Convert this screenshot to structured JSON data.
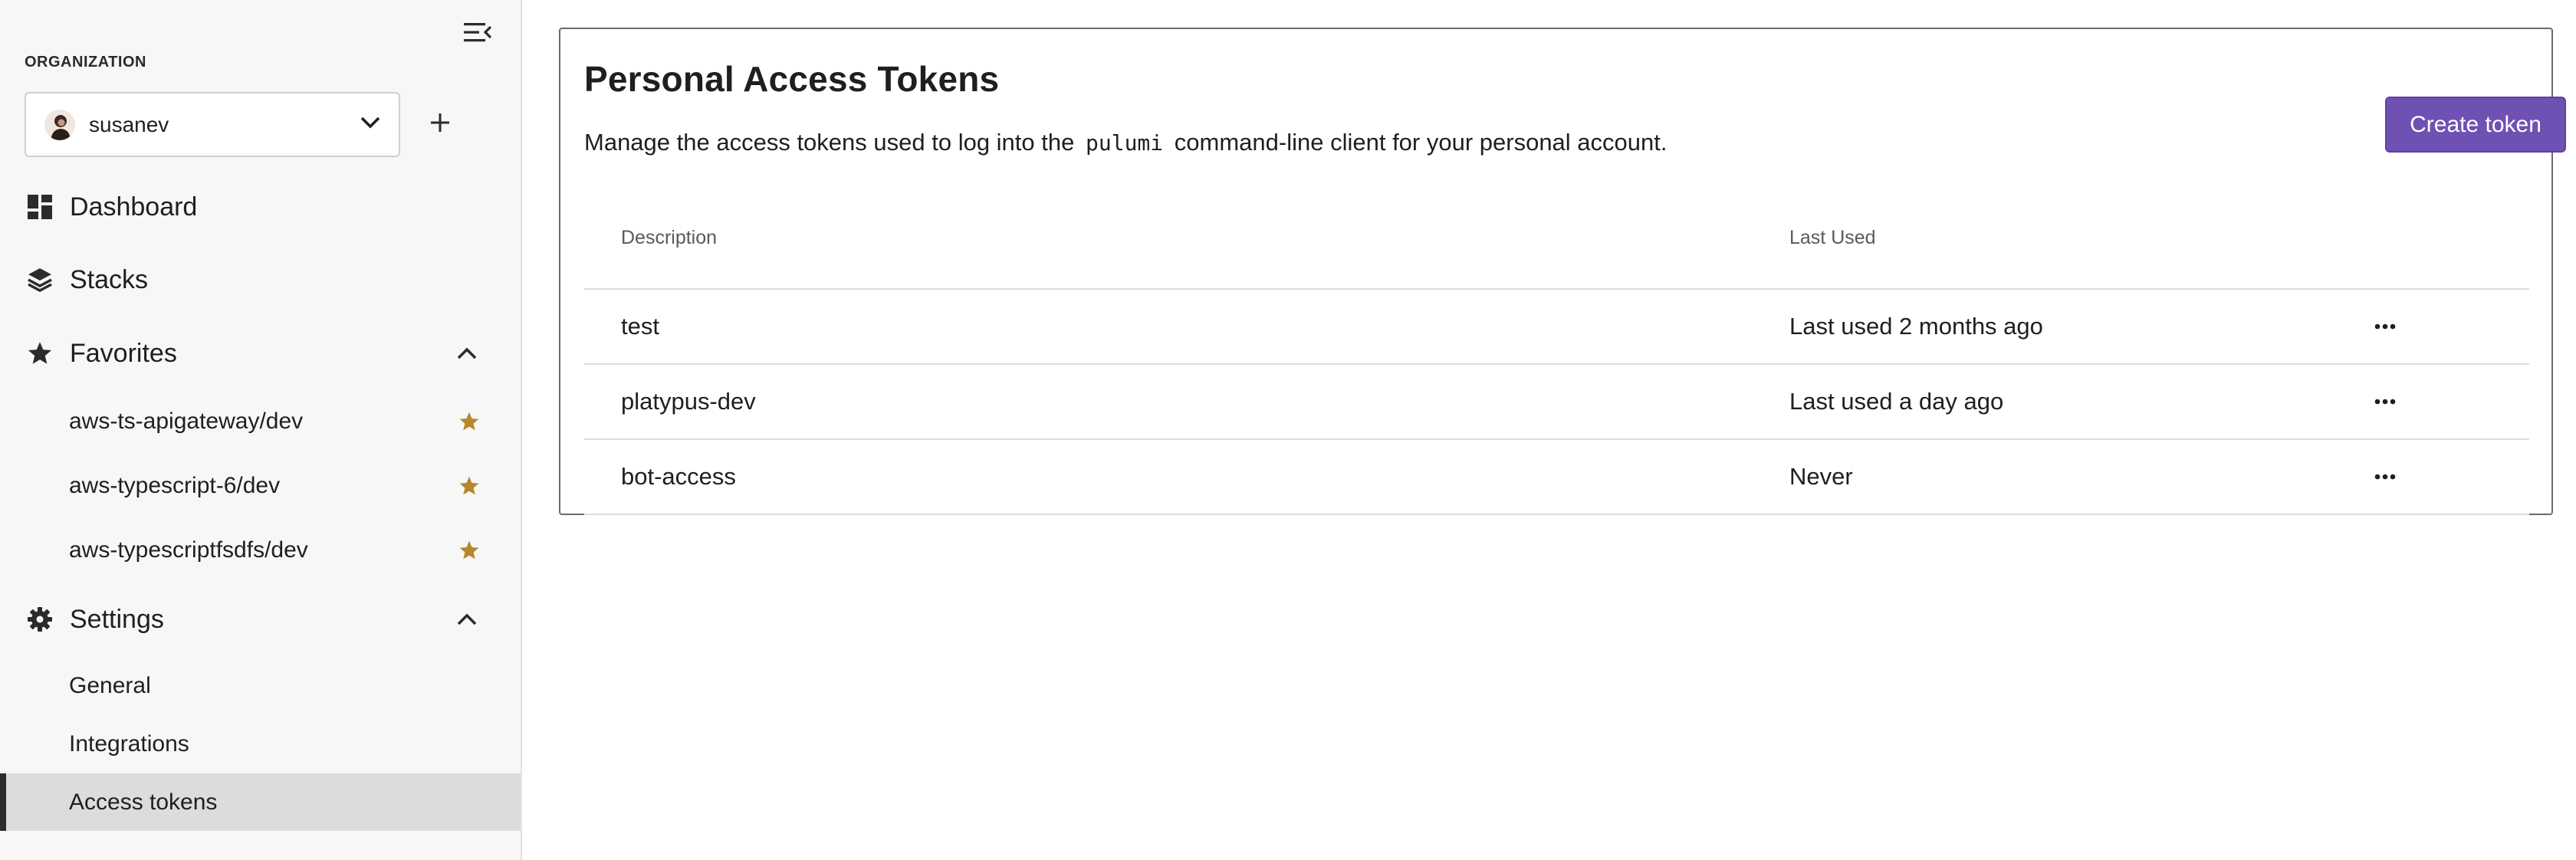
{
  "sidebar": {
    "collapse_icon": "menu-collapse-icon",
    "organization_label": "ORGANIZATION",
    "organization": {
      "name": "susanev",
      "avatar_icon": "user-avatar",
      "chevron_icon": "chevron-down-icon",
      "add_icon": "plus-icon"
    },
    "nav": [
      {
        "label": "Dashboard",
        "icon": "dashboard-icon"
      },
      {
        "label": "Stacks",
        "icon": "layers-icon"
      },
      {
        "label": "Favorites",
        "icon": "star-icon",
        "expanded": true
      },
      {
        "label": "Settings",
        "icon": "gear-icon",
        "expanded": true
      }
    ],
    "favorites": [
      {
        "label": "aws-ts-apigateway/dev",
        "icon": "star-icon"
      },
      {
        "label": "aws-typescript-6/dev",
        "icon": "star-icon"
      },
      {
        "label": "aws-typescriptfsdfs/dev",
        "icon": "star-icon"
      }
    ],
    "settings_items": [
      {
        "label": "General"
      },
      {
        "label": "Integrations"
      },
      {
        "label": "Access tokens",
        "active": true
      }
    ],
    "colors": {
      "star": "#b8862b",
      "active_bg": "#dcdcdc",
      "active_bar": "#2b2b2b"
    }
  },
  "main": {
    "title": "Personal Access Tokens",
    "description_before": "Manage the access tokens used to log into the",
    "description_code": "pulumi",
    "description_after": "command-line client for your personal account.",
    "create_button": "Create token",
    "colors": {
      "primary": "#6f51b3"
    },
    "table": {
      "columns": [
        "Description",
        "Last Used"
      ],
      "rows": [
        {
          "description": "test",
          "last_used": "Last used 2 months ago"
        },
        {
          "description": "platypus-dev",
          "last_used": "Last used a day ago"
        },
        {
          "description": "bot-access",
          "last_used": "Never"
        }
      ],
      "row_action_icon": "more-horizontal-icon"
    }
  }
}
